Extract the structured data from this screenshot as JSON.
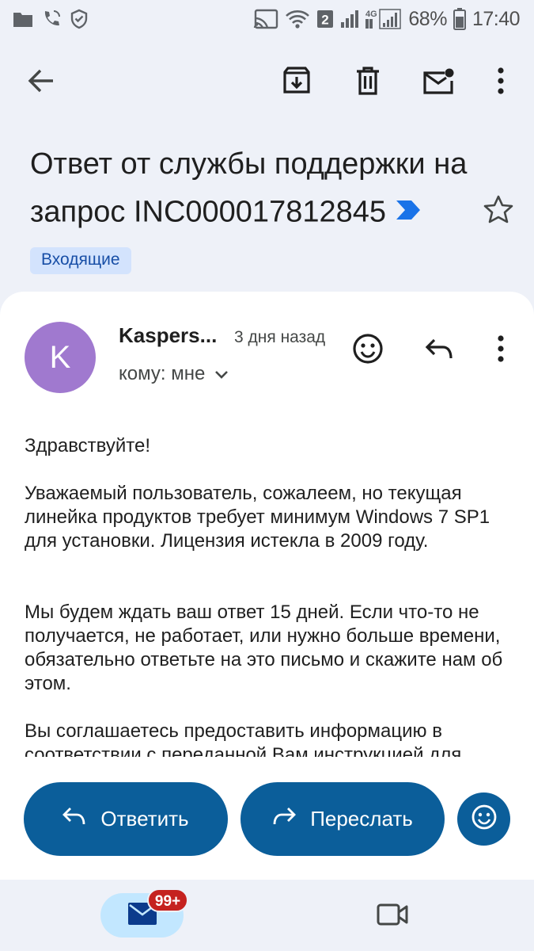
{
  "status_bar": {
    "battery_percent": "68%",
    "time": "17:40",
    "sim_slot": "2",
    "network": "4G",
    "icons": [
      "folder-icon",
      "wifi-calling-icon",
      "shield-check-icon",
      "screen-cast-icon",
      "wifi-icon",
      "signal-icon",
      "signal-4g-icon",
      "battery-icon"
    ]
  },
  "app_bar": {
    "icons": [
      "back-arrow-icon",
      "archive-icon",
      "delete-icon",
      "mark-unread-icon",
      "more-vert-icon"
    ]
  },
  "email": {
    "subject": "Ответ от службы поддержки на запрос INC000017812845",
    "label": "Входящие",
    "sender_initial": "K",
    "sender_name": "Kaspers...",
    "time": "3 дня назад",
    "recipients": "кому: мне",
    "body": [
      "Здравствуйте!",
      "Уважаемый пользователь, сожалеем, но текущая линейка продуктов требует минимум Windows 7 SP1 для установки. Лицензия истекла в 2009 году.",
      "Мы будем ждать ваш ответ 15 дней. Если что-то не получается, не работает, или нужно больше времени, обязательно ответьте на это письмо и скажите нам об этом.",
      "Вы соглашаетесь предоставить информацию в соответствии с переданной Вам инструкцией для"
    ]
  },
  "actions": {
    "reply_label": "Ответить",
    "forward_label": "Переслать"
  },
  "bottom_nav": {
    "mail_badge": "99+"
  },
  "colors": {
    "background": "#eef1f8",
    "avatar": "#a079cf",
    "button": "#0b5e9a",
    "label_chip": "#d3e3fd",
    "nav_active": "#c2e7ff",
    "badge": "#c5221f"
  }
}
